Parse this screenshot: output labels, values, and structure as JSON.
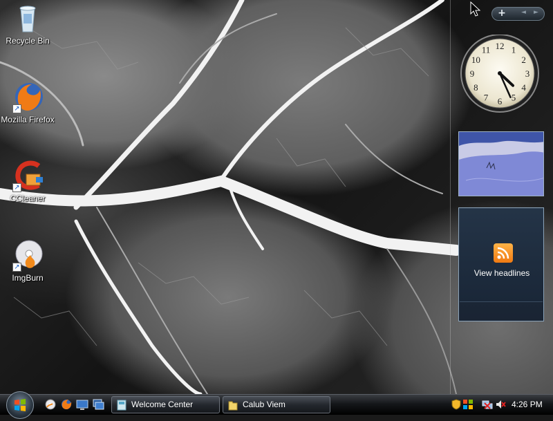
{
  "desktop": {
    "icons": [
      {
        "label": "Recycle Bin"
      },
      {
        "label": "Mozilla Firefox"
      },
      {
        "label": "CCleaner"
      },
      {
        "label": "ImgBurn"
      }
    ]
  },
  "sidebar": {
    "add_button": "+",
    "nav_prev": "◄",
    "nav_next": "►",
    "clock": {
      "hour": 4,
      "minute": 26
    },
    "feed": {
      "headline_label": "View headlines"
    }
  },
  "taskbar": {
    "buttons": [
      {
        "label": "Welcome Center"
      },
      {
        "label": "Calub Viem"
      }
    ],
    "time": "4:26 PM"
  },
  "colors": {
    "rss_orange": "#f58a1f",
    "taskbar": "#000000"
  }
}
